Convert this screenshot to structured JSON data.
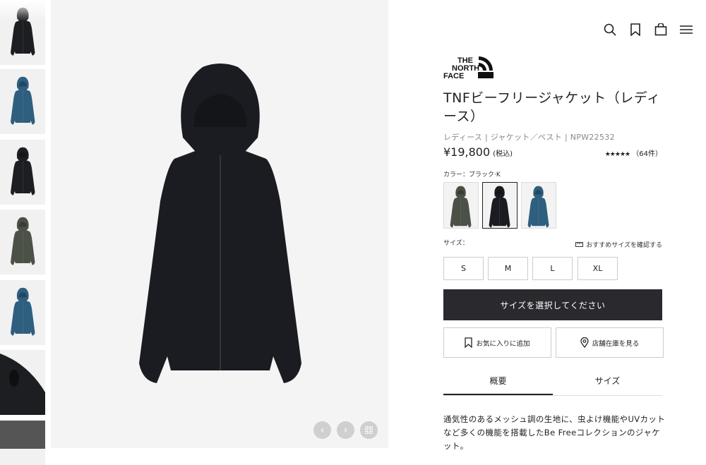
{
  "header": {
    "icons": [
      "search-icon",
      "bookmark-icon",
      "cart-icon",
      "menu-icon"
    ]
  },
  "gallery": {
    "thumbnails": [
      {
        "color": "#1d1e22"
      },
      {
        "color": "#2e5f7f"
      },
      {
        "color": "#1d1e22"
      },
      {
        "color": "#4b5146"
      },
      {
        "color": "#2e5f7f"
      },
      {
        "color": "#1d1e22"
      },
      {
        "color": "#555555"
      }
    ],
    "main_color": "#1b1c21",
    "nav": {
      "prev_icon": "chevron-left-icon",
      "next_icon": "chevron-right-icon",
      "grid_icon": "grid-icon"
    }
  },
  "product": {
    "logo_lines": [
      "THE",
      "NORTH",
      "FACE"
    ],
    "title": "TNFビーフリージャケット（レディース）",
    "category": "レディース | ジャケット／ベスト | NPW22532",
    "price": "¥19,800",
    "tax_note": "(税込)",
    "stars": "★★★★★",
    "review_count": "（64件）",
    "color_label": "カラー：ブラック·K",
    "swatches": [
      {
        "name": "khaki",
        "color": "#4b5146"
      },
      {
        "name": "black",
        "color": "#1b1c21"
      },
      {
        "name": "blue",
        "color": "#2e5f7f"
      }
    ],
    "size_label": "サイズ：",
    "size_guide": "おすすめサイズを確認する",
    "sizes": [
      "S",
      "M",
      "L",
      "XL"
    ],
    "cta": "サイズを選択してください",
    "favorite": "お気に入りに追加",
    "store_stock": "店舗在庫を見る",
    "tabs": [
      "概要",
      "サイズ"
    ],
    "description": "通気性のあるメッシュ調の生地に、虫よけ機能やUVカットなど多くの機能を搭載したBe Freeコレクションのジャケット。"
  }
}
